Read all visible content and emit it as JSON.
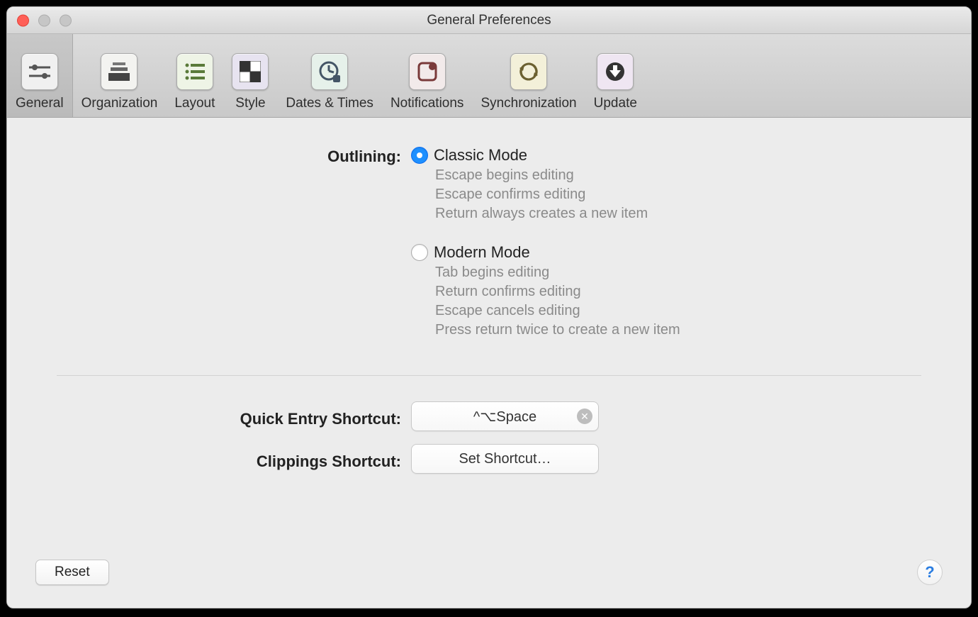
{
  "window": {
    "title": "General Preferences"
  },
  "toolbar": {
    "items": [
      {
        "label": "General"
      },
      {
        "label": "Organization"
      },
      {
        "label": "Layout"
      },
      {
        "label": "Style"
      },
      {
        "label": "Dates & Times"
      },
      {
        "label": "Notifications"
      },
      {
        "label": "Synchronization"
      },
      {
        "label": "Update"
      }
    ]
  },
  "outlining": {
    "label": "Outlining:",
    "classic": {
      "title": "Classic Mode",
      "line1": "Escape begins editing",
      "line2": "Escape confirms editing",
      "line3": "Return always creates a new item"
    },
    "modern": {
      "title": "Modern Mode",
      "line1": "Tab begins editing",
      "line2": "Return confirms editing",
      "line3": "Escape cancels editing",
      "line4": "Press return twice to create a new item"
    }
  },
  "quick_entry": {
    "label": "Quick Entry Shortcut:",
    "value": "^⌥Space"
  },
  "clippings": {
    "label": "Clippings Shortcut:",
    "value": "Set Shortcut…"
  },
  "footer": {
    "reset": "Reset",
    "help": "?"
  }
}
